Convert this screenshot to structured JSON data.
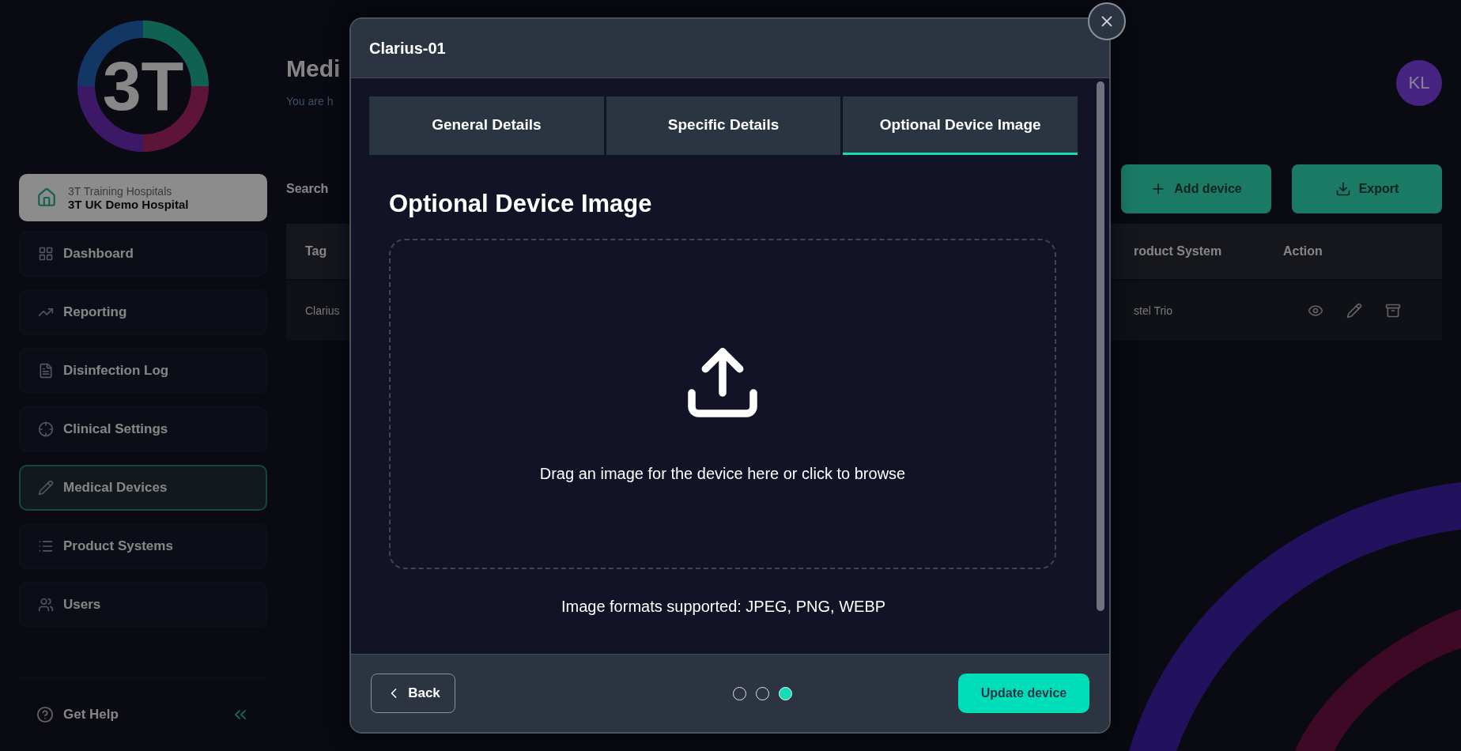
{
  "sidebar": {
    "logo": "3T",
    "organization": {
      "group": "3T Training Hospitals",
      "name": "3T UK Demo Hospital"
    },
    "items": [
      {
        "label": "Dashboard",
        "selected": false
      },
      {
        "label": "Reporting",
        "selected": false
      },
      {
        "label": "Disinfection Log",
        "selected": false
      },
      {
        "label": "Clinical Settings",
        "selected": false
      },
      {
        "label": "Medical Devices",
        "selected": true
      },
      {
        "label": "Product Systems",
        "selected": false
      },
      {
        "label": "Users",
        "selected": false
      }
    ],
    "help": "Get Help"
  },
  "page": {
    "title": "Medi",
    "subtitle": "You are h",
    "search_label": "Search",
    "buttons": [
      "Add device",
      "Export"
    ],
    "avatar": "KL",
    "table": {
      "columns": [
        "Tag",
        "roduct System",
        "Action"
      ],
      "rows": [
        {
          "tag": "Clarius",
          "product_system": "stel Trio"
        }
      ]
    }
  },
  "modal": {
    "title": "Clarius-01",
    "tabs": [
      {
        "label": "General Details",
        "selected": false
      },
      {
        "label": "Specific Details",
        "selected": false
      },
      {
        "label": "Optional Device Image",
        "selected": true
      }
    ],
    "heading": "Optional Device Image",
    "dropzone_text": "Drag an image for the device here or click to browse",
    "formats": "Image formats supported: JPEG, PNG, WEBP",
    "back": "Back",
    "steps": [
      {
        "selected": false
      },
      {
        "selected": false
      },
      {
        "selected": true
      }
    ],
    "submit": "Update device"
  }
}
